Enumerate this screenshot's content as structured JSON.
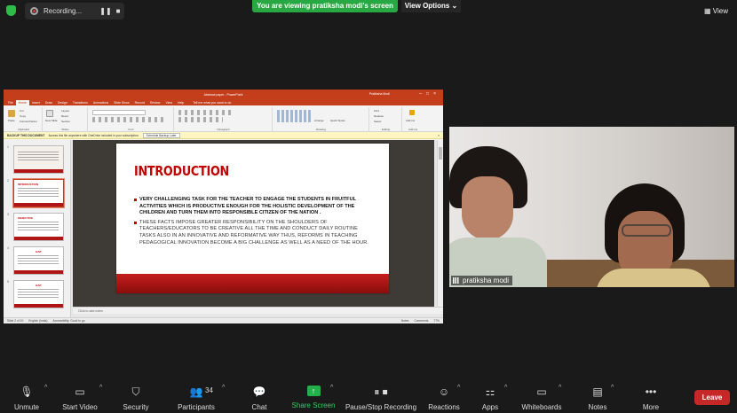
{
  "top_bar": {
    "recording_label": "Recording...",
    "pause_glyph": "❚❚",
    "stop_glyph": "■",
    "viewing_banner": "You are viewing pratiksha modi's screen",
    "view_options": "View Options",
    "view_button": "View"
  },
  "ppt": {
    "window_title": "Abstract paper - PowerPoint",
    "user": "Pratiksha Modi",
    "tabs": [
      "File",
      "Home",
      "Insert",
      "Draw",
      "Design",
      "Transitions",
      "Animations",
      "Slide Show",
      "Record",
      "Review",
      "View",
      "Help"
    ],
    "tell_me": "Tell me what you want to do",
    "ribbon_groups": [
      "Clipboard",
      "Slides",
      "Font",
      "Paragraph",
      "Drawing",
      "Editing",
      "Add-ins"
    ],
    "ribbon_items": {
      "paste": "Paste",
      "cut": "Cut",
      "copy": "Copy",
      "format_painter": "Format Painter",
      "new_slide": "New Slide",
      "layout": "Layout",
      "reset": "Reset",
      "section": "Section",
      "arrange": "Arrange",
      "quick_styles": "Quick Styles",
      "find": "Find",
      "replace": "Replace",
      "select": "Select",
      "addins": "Add-ins"
    },
    "backup_bar": {
      "title": "BACKUP THIS DOCUMENT",
      "message": "Access this file anywhere with OneDrive included in your subscription.",
      "button": "Schedule Backup Later",
      "close": "×"
    },
    "thumbnails": [
      {
        "num": "1",
        "title": ""
      },
      {
        "num": "2",
        "title": "INTRODUCTION"
      },
      {
        "num": "3",
        "title": "OBJECTIVE"
      },
      {
        "num": "4",
        "title": "GAP"
      },
      {
        "num": "5",
        "title": "GAP"
      }
    ],
    "slide": {
      "title": "INTRODUCTION",
      "bullet1": "VERY CHALLENGING TASK FOR THE TEACHER  TO ENGAGE THE STUDENTS  IN FRUITFUL ACTIVITIES WHICH IS PRODUCTIVE ENOUGH FOR THE HOLISTIC  DEVELOPMENT OF THE CHILDREN AND TURN THEM INTO RESPONSIBLE CITIZEN OF THE NATION .",
      "bullet2": "THESE FACTS IMPOSE GREATER RESPONSIBILITY ON THE SHOULDERS OF TEACHERS/EDUCATORS TO BE CREATIVE ALL THE TIME AND CONDUCT DAILY ROUTINE TASKS ALSO IN AN INNOVATIVE AND REFORMATIVE WAY THUS, REFORMS IN TEACHING PEDAGOGICAL INNOVATION BECOME A BIG CHALLENGE AS WELL AS A NEED OF THE HOUR."
    },
    "notes_placeholder": "Click to add notes",
    "status": {
      "slide_count": "Slide 2 of 10",
      "language": "English (India)",
      "accessibility": "Accessibility: Good to go",
      "notes": "Notes",
      "comments": "Comments",
      "zoom": "77%"
    }
  },
  "video": {
    "participant_name": "pratiksha modi"
  },
  "toolbar": {
    "items": [
      {
        "label": "Unmute",
        "icon": "microphone-muted-icon"
      },
      {
        "label": "Start Video",
        "icon": "video-off-icon"
      },
      {
        "label": "Security",
        "icon": "shield-icon"
      },
      {
        "label": "Participants",
        "icon": "participants-icon",
        "count": "34"
      },
      {
        "label": "Chat",
        "icon": "chat-icon"
      },
      {
        "label": "Share Screen",
        "icon": "share-screen-icon"
      },
      {
        "label": "Pause/Stop Recording",
        "icon": "pause-stop-icon"
      },
      {
        "label": "Reactions",
        "icon": "reactions-icon"
      },
      {
        "label": "Apps",
        "icon": "apps-icon"
      },
      {
        "label": "Whiteboards",
        "icon": "whiteboard-icon"
      },
      {
        "label": "Notes",
        "icon": "notes-icon"
      },
      {
        "label": "More",
        "icon": "more-icon"
      }
    ],
    "leave": "Leave"
  },
  "colors": {
    "ppt_accent": "#c43e1c",
    "slide_title": "#c00000",
    "banner_green": "#27a842",
    "leave_red": "#c62828",
    "share_green": "#22b04a"
  }
}
